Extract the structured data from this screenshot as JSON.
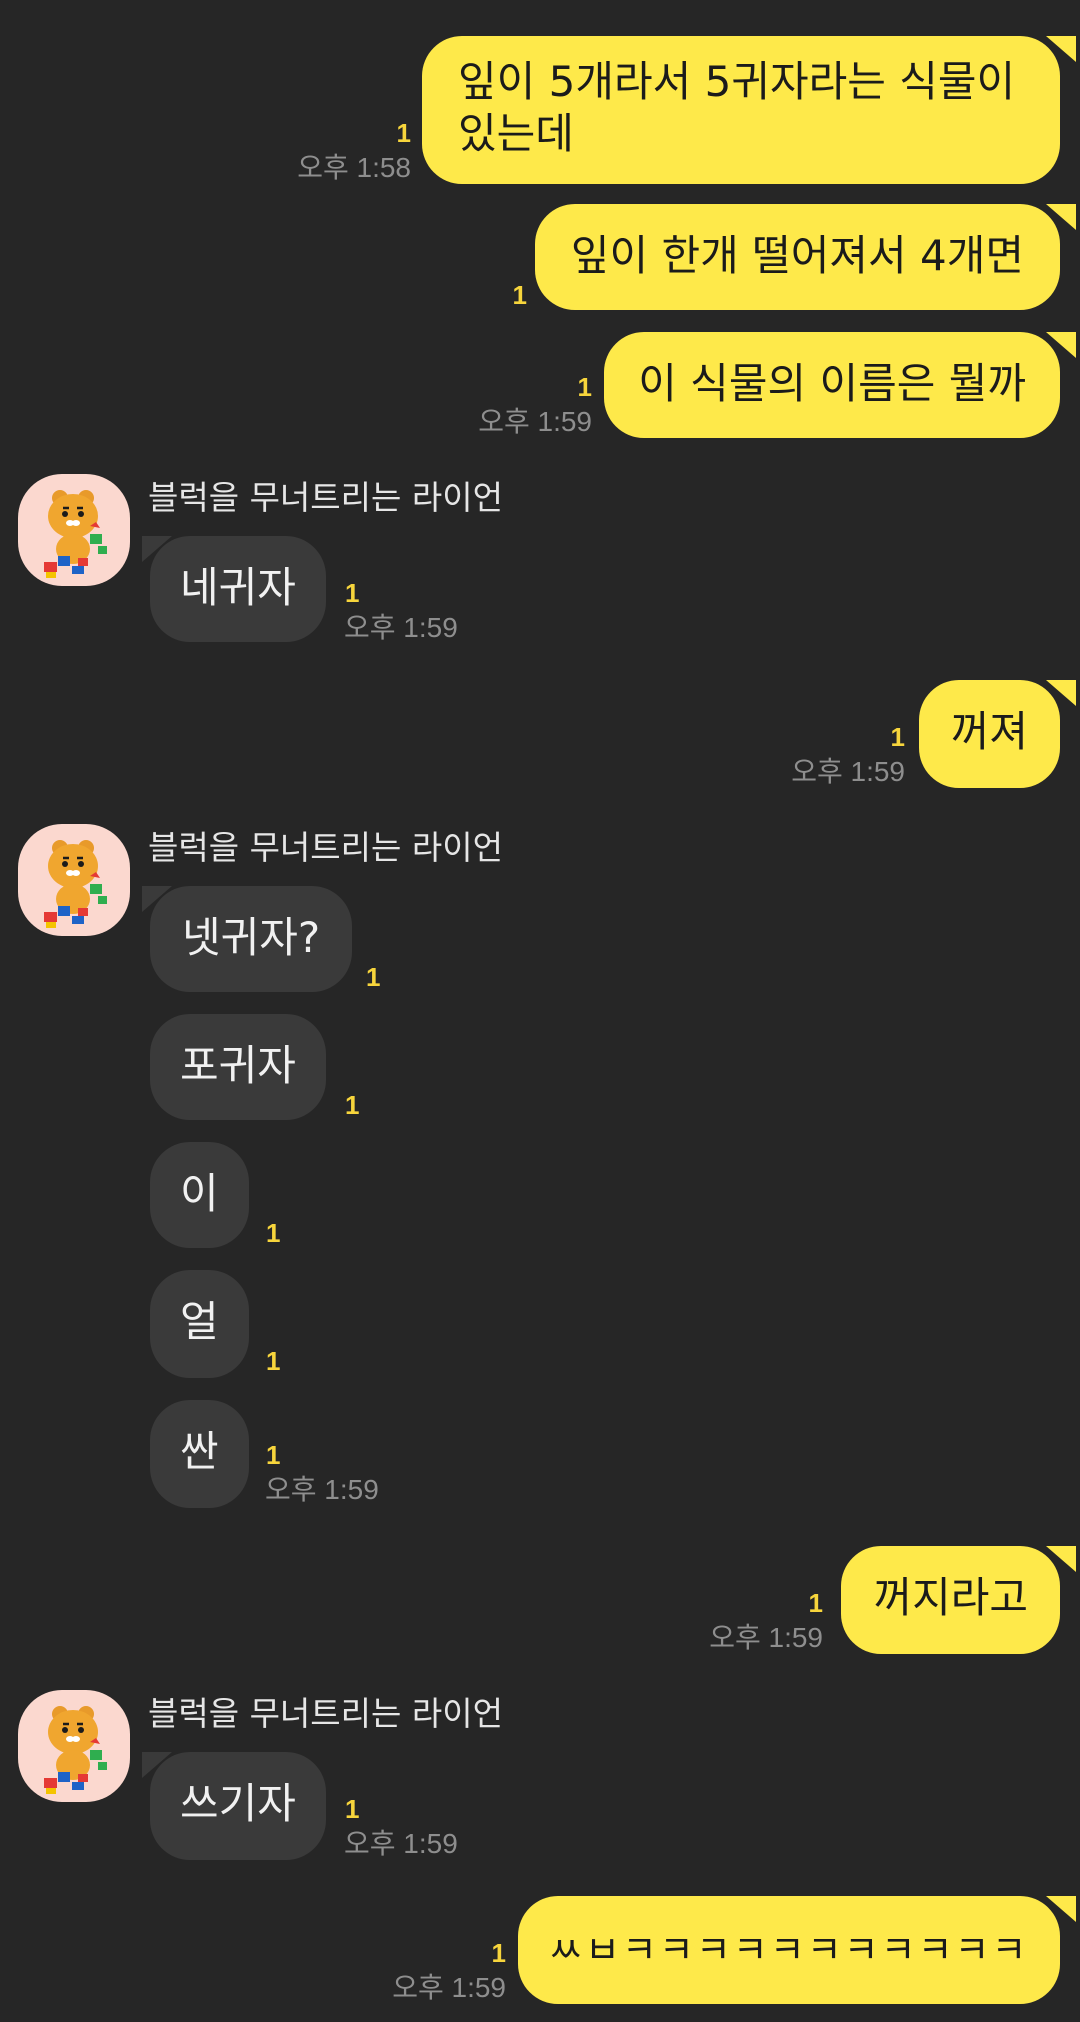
{
  "messages": [
    {
      "side": "mine",
      "text_lines": [
        "잎이 5개라서 5귀자라는 식물이",
        "있는데"
      ],
      "unread": "1",
      "time": "오후 1:58"
    },
    {
      "side": "mine",
      "text": "잎이 한개 떨어져서 4개면",
      "unread": "1"
    },
    {
      "side": "mine",
      "text": "이 식물의 이름은 뭘까",
      "unread": "1",
      "time": "오후 1:59"
    },
    {
      "side": "theirs",
      "sender": "블럭을 무너트리는 라이언",
      "text": "네귀자",
      "unread": "1",
      "time": "오후 1:59"
    },
    {
      "side": "mine",
      "text": "꺼져",
      "unread": "1",
      "time": "오후 1:59"
    },
    {
      "side": "theirs",
      "sender": "블럭을 무너트리는 라이언",
      "text": "넷귀자?",
      "unread": "1"
    },
    {
      "side": "theirs",
      "text": "포귀자",
      "unread": "1"
    },
    {
      "side": "theirs",
      "text": "이",
      "unread": "1"
    },
    {
      "side": "theirs",
      "text": "얼",
      "unread": "1"
    },
    {
      "side": "theirs",
      "text": "싼",
      "unread": "1",
      "time": "오후 1:59"
    },
    {
      "side": "mine",
      "text": "꺼지라고",
      "unread": "1",
      "time": "오후 1:59"
    },
    {
      "side": "theirs",
      "sender": "블럭을 무너트리는 라이언",
      "text": "쓰기자",
      "unread": "1",
      "time": "오후 1:59"
    },
    {
      "side": "mine",
      "text": "ㅆㅂㅋㅋㅋㅋㅋㅋㅋㅋㅋㅋㅋ",
      "unread": "1",
      "time": "오후 1:59"
    }
  ],
  "avatar_icon": "ryan-lion-character-icon",
  "colors": {
    "background": "#262626",
    "my_bubble": "#fee94a",
    "their_bubble": "#3a3a3a",
    "unread_count": "#f7d53c",
    "timestamp": "#8e8e8e",
    "avatar_bg": "#fbd8cf"
  }
}
